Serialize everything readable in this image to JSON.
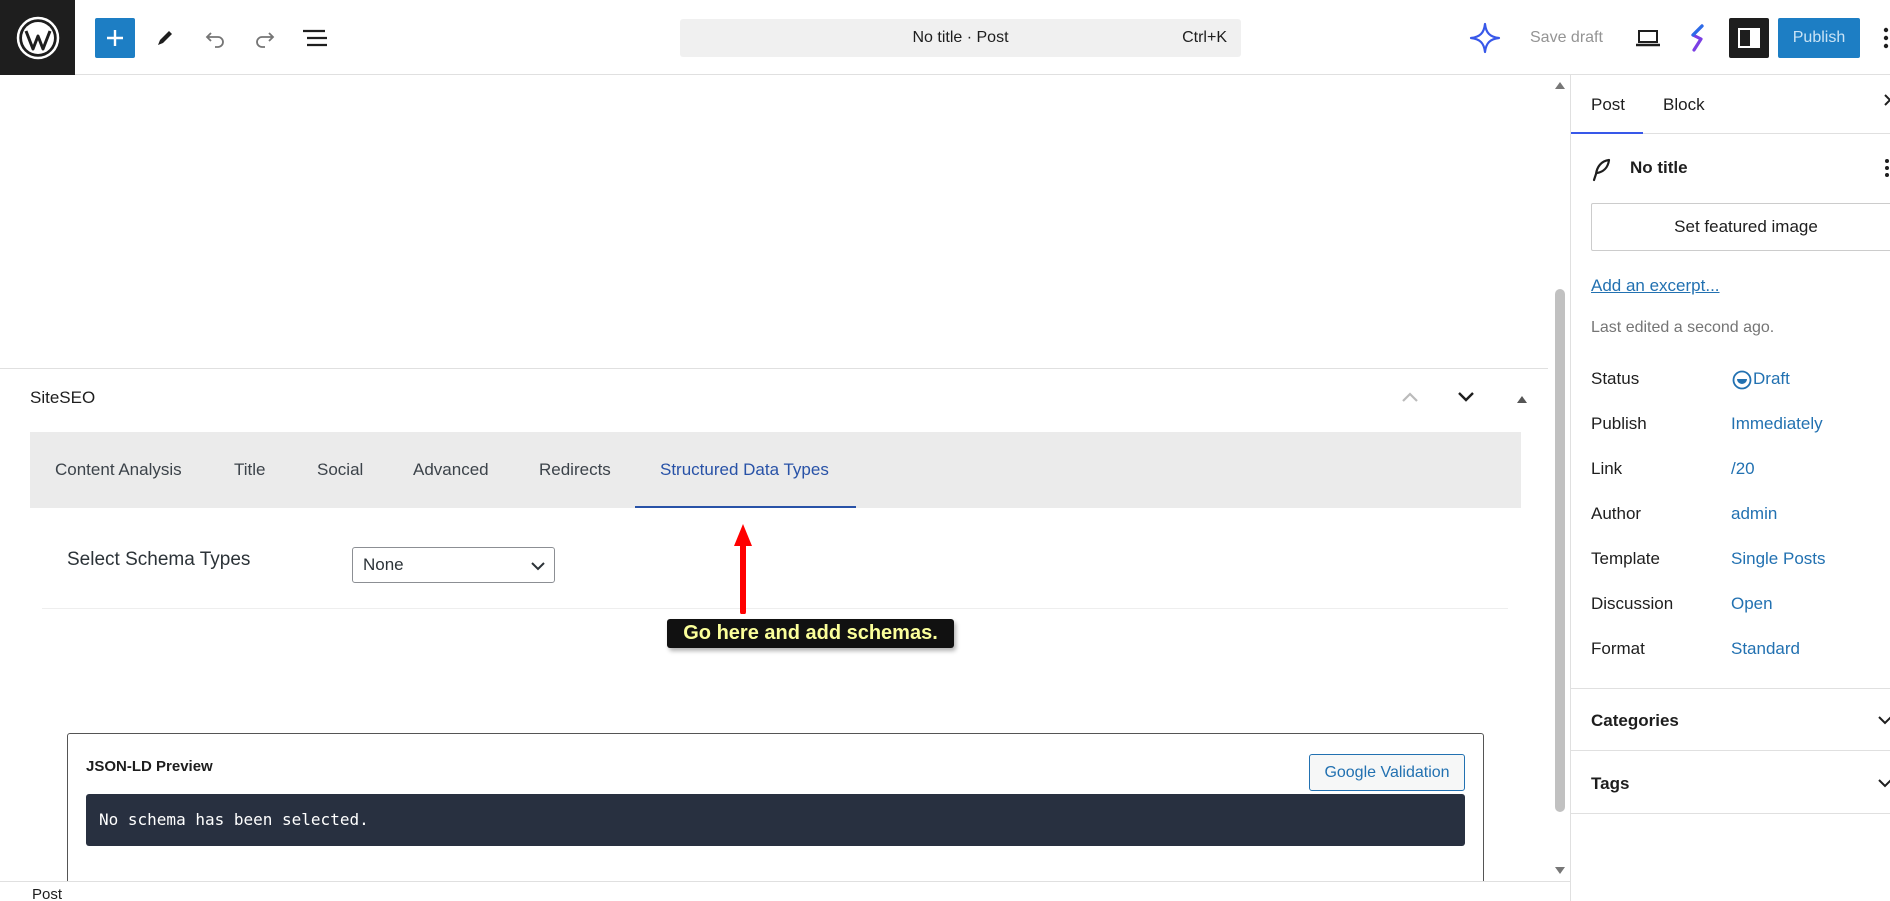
{
  "topbar": {
    "doc_title": "No title · Post",
    "shortcut": "Ctrl+K",
    "save_draft": "Save draft",
    "publish": "Publish"
  },
  "seo": {
    "heading": "SiteSEO",
    "tabs": [
      {
        "label": "Content Analysis"
      },
      {
        "label": "Title"
      },
      {
        "label": "Social"
      },
      {
        "label": "Advanced"
      },
      {
        "label": "Redirects"
      },
      {
        "label": "Structured Data Types"
      }
    ],
    "active_tab": "Structured Data Types",
    "schema_label": "Select Schema Types",
    "schema_value": "None",
    "json_preview_title": "JSON-LD Preview",
    "google_validation": "Google Validation",
    "json_code": "No schema has been selected."
  },
  "annotation": {
    "text": "Go here and add schemas.",
    "arrow_color": "#ff0000"
  },
  "footer": {
    "breadcrumb": "Post"
  },
  "sidebar": {
    "tabs": [
      "Post",
      "Block"
    ],
    "post_title": "No title",
    "featured_image": "Set featured image",
    "excerpt_link": "Add an excerpt...",
    "last_edited": "Last edited a second ago.",
    "meta": [
      {
        "label": "Status",
        "value": "Draft"
      },
      {
        "label": "Publish",
        "value": "Immediately"
      },
      {
        "label": "Link",
        "value": "/20"
      },
      {
        "label": "Author",
        "value": "admin"
      },
      {
        "label": "Template",
        "value": "Single Posts"
      },
      {
        "label": "Discussion",
        "value": "Open"
      },
      {
        "label": "Format",
        "value": "Standard"
      }
    ],
    "panels": [
      "Categories",
      "Tags"
    ]
  },
  "colors": {
    "accent": "#1d7ec4",
    "active_tab": "#2852a7",
    "link": "#2271b1",
    "callout_text": "#fbff9a"
  }
}
